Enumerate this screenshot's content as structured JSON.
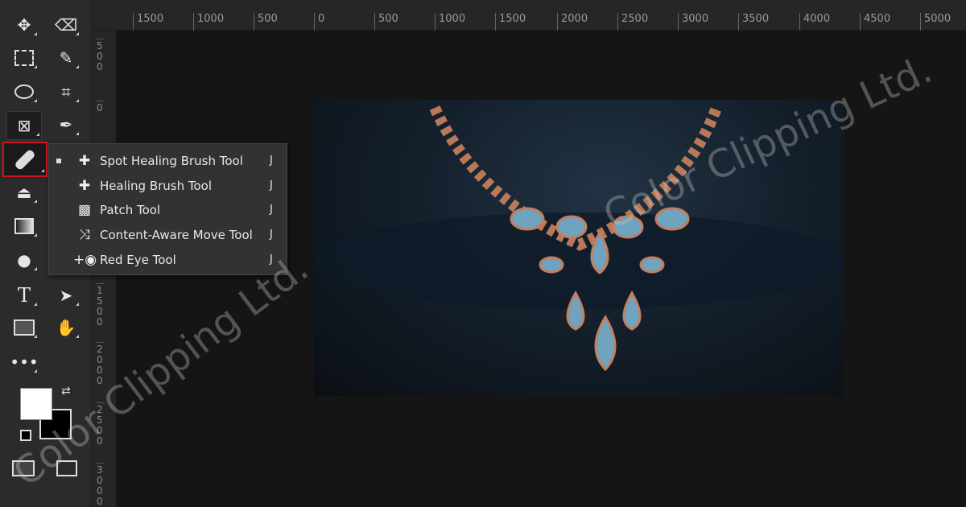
{
  "toolbar": {
    "tools": [
      "move-tool",
      "eraser-tool",
      "rectangular-marquee-tool",
      "quick-selection-tool",
      "lasso-tool",
      "crop-tool",
      "frame-tool",
      "eyedropper-tool",
      "spot-healing-brush-tool",
      "clone-stamp-tool",
      "gradient-tool",
      "dodge-tool",
      "type-tool",
      "path-selection-tool",
      "rectangle-tool",
      "hand-tool",
      "more-tools"
    ],
    "foreground_color": "#ffffff",
    "background_color": "#000000",
    "selected_tool_highlight": "#d0141c"
  },
  "ruler_top": [
    "1500",
    "1000",
    "500",
    "0",
    "500",
    "1000",
    "1500",
    "2000",
    "2500",
    "3000",
    "3500",
    "4000",
    "4500",
    "5000"
  ],
  "ruler_left": [
    "500",
    "0",
    "1500",
    "2000",
    "2500",
    "3000"
  ],
  "flyout": {
    "items": [
      {
        "label": "Spot Healing Brush Tool",
        "shortcut": "J",
        "icon": "spot-healing-icon",
        "active": true
      },
      {
        "label": "Healing Brush Tool",
        "shortcut": "J",
        "icon": "bandage-icon"
      },
      {
        "label": "Patch Tool",
        "shortcut": "J",
        "icon": "patch-icon"
      },
      {
        "label": "Content-Aware Move Tool",
        "shortcut": "J",
        "icon": "content-aware-move-icon"
      },
      {
        "label": "Red Eye Tool",
        "shortcut": "J",
        "icon": "red-eye-icon"
      }
    ]
  },
  "watermark": "Color Clipping Ltd."
}
